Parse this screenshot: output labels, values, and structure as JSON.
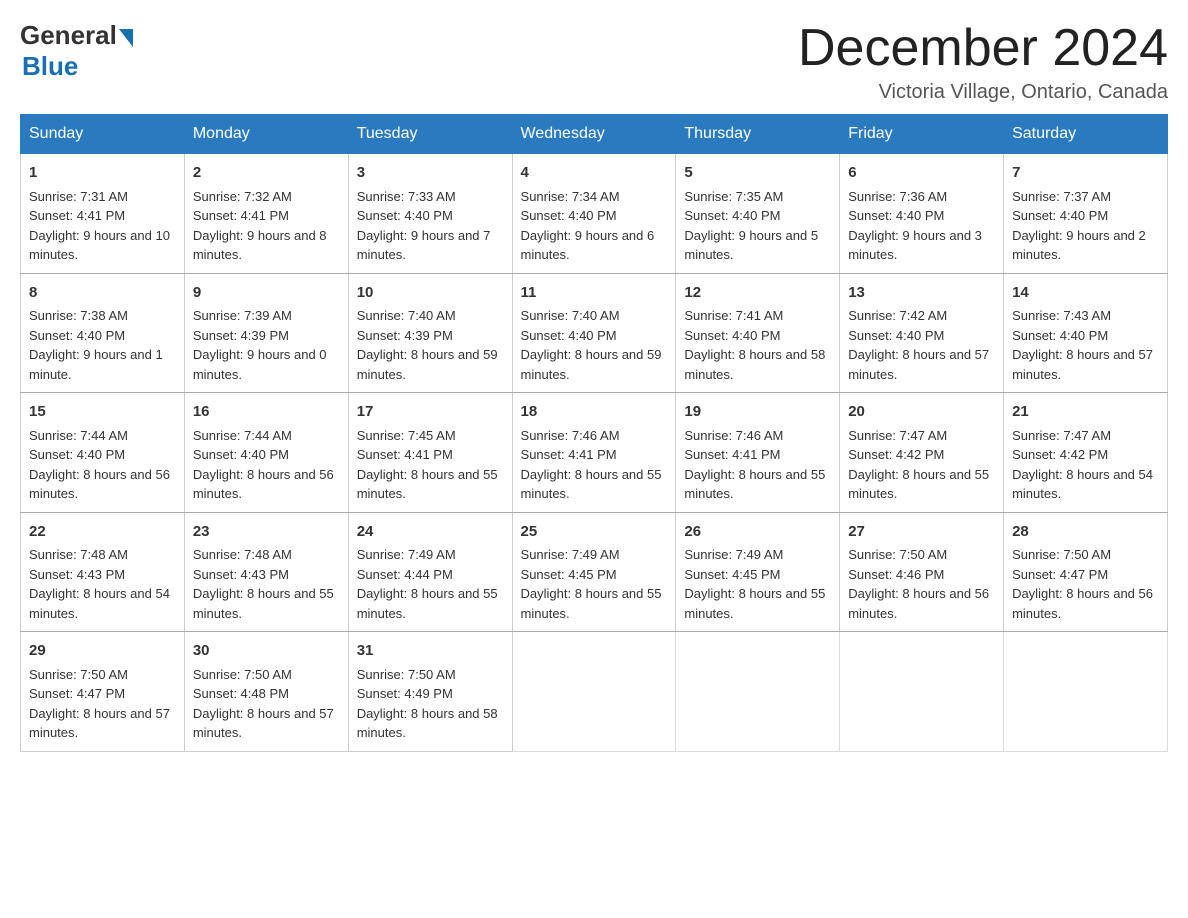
{
  "header": {
    "logo_general": "General",
    "logo_blue": "Blue",
    "month_title": "December 2024",
    "location": "Victoria Village, Ontario, Canada"
  },
  "days_of_week": [
    "Sunday",
    "Monday",
    "Tuesday",
    "Wednesday",
    "Thursday",
    "Friday",
    "Saturday"
  ],
  "weeks": [
    [
      {
        "day": "1",
        "sunrise": "Sunrise: 7:31 AM",
        "sunset": "Sunset: 4:41 PM",
        "daylight": "Daylight: 9 hours and 10 minutes."
      },
      {
        "day": "2",
        "sunrise": "Sunrise: 7:32 AM",
        "sunset": "Sunset: 4:41 PM",
        "daylight": "Daylight: 9 hours and 8 minutes."
      },
      {
        "day": "3",
        "sunrise": "Sunrise: 7:33 AM",
        "sunset": "Sunset: 4:40 PM",
        "daylight": "Daylight: 9 hours and 7 minutes."
      },
      {
        "day": "4",
        "sunrise": "Sunrise: 7:34 AM",
        "sunset": "Sunset: 4:40 PM",
        "daylight": "Daylight: 9 hours and 6 minutes."
      },
      {
        "day": "5",
        "sunrise": "Sunrise: 7:35 AM",
        "sunset": "Sunset: 4:40 PM",
        "daylight": "Daylight: 9 hours and 5 minutes."
      },
      {
        "day": "6",
        "sunrise": "Sunrise: 7:36 AM",
        "sunset": "Sunset: 4:40 PM",
        "daylight": "Daylight: 9 hours and 3 minutes."
      },
      {
        "day": "7",
        "sunrise": "Sunrise: 7:37 AM",
        "sunset": "Sunset: 4:40 PM",
        "daylight": "Daylight: 9 hours and 2 minutes."
      }
    ],
    [
      {
        "day": "8",
        "sunrise": "Sunrise: 7:38 AM",
        "sunset": "Sunset: 4:40 PM",
        "daylight": "Daylight: 9 hours and 1 minute."
      },
      {
        "day": "9",
        "sunrise": "Sunrise: 7:39 AM",
        "sunset": "Sunset: 4:39 PM",
        "daylight": "Daylight: 9 hours and 0 minutes."
      },
      {
        "day": "10",
        "sunrise": "Sunrise: 7:40 AM",
        "sunset": "Sunset: 4:39 PM",
        "daylight": "Daylight: 8 hours and 59 minutes."
      },
      {
        "day": "11",
        "sunrise": "Sunrise: 7:40 AM",
        "sunset": "Sunset: 4:40 PM",
        "daylight": "Daylight: 8 hours and 59 minutes."
      },
      {
        "day": "12",
        "sunrise": "Sunrise: 7:41 AM",
        "sunset": "Sunset: 4:40 PM",
        "daylight": "Daylight: 8 hours and 58 minutes."
      },
      {
        "day": "13",
        "sunrise": "Sunrise: 7:42 AM",
        "sunset": "Sunset: 4:40 PM",
        "daylight": "Daylight: 8 hours and 57 minutes."
      },
      {
        "day": "14",
        "sunrise": "Sunrise: 7:43 AM",
        "sunset": "Sunset: 4:40 PM",
        "daylight": "Daylight: 8 hours and 57 minutes."
      }
    ],
    [
      {
        "day": "15",
        "sunrise": "Sunrise: 7:44 AM",
        "sunset": "Sunset: 4:40 PM",
        "daylight": "Daylight: 8 hours and 56 minutes."
      },
      {
        "day": "16",
        "sunrise": "Sunrise: 7:44 AM",
        "sunset": "Sunset: 4:40 PM",
        "daylight": "Daylight: 8 hours and 56 minutes."
      },
      {
        "day": "17",
        "sunrise": "Sunrise: 7:45 AM",
        "sunset": "Sunset: 4:41 PM",
        "daylight": "Daylight: 8 hours and 55 minutes."
      },
      {
        "day": "18",
        "sunrise": "Sunrise: 7:46 AM",
        "sunset": "Sunset: 4:41 PM",
        "daylight": "Daylight: 8 hours and 55 minutes."
      },
      {
        "day": "19",
        "sunrise": "Sunrise: 7:46 AM",
        "sunset": "Sunset: 4:41 PM",
        "daylight": "Daylight: 8 hours and 55 minutes."
      },
      {
        "day": "20",
        "sunrise": "Sunrise: 7:47 AM",
        "sunset": "Sunset: 4:42 PM",
        "daylight": "Daylight: 8 hours and 55 minutes."
      },
      {
        "day": "21",
        "sunrise": "Sunrise: 7:47 AM",
        "sunset": "Sunset: 4:42 PM",
        "daylight": "Daylight: 8 hours and 54 minutes."
      }
    ],
    [
      {
        "day": "22",
        "sunrise": "Sunrise: 7:48 AM",
        "sunset": "Sunset: 4:43 PM",
        "daylight": "Daylight: 8 hours and 54 minutes."
      },
      {
        "day": "23",
        "sunrise": "Sunrise: 7:48 AM",
        "sunset": "Sunset: 4:43 PM",
        "daylight": "Daylight: 8 hours and 55 minutes."
      },
      {
        "day": "24",
        "sunrise": "Sunrise: 7:49 AM",
        "sunset": "Sunset: 4:44 PM",
        "daylight": "Daylight: 8 hours and 55 minutes."
      },
      {
        "day": "25",
        "sunrise": "Sunrise: 7:49 AM",
        "sunset": "Sunset: 4:45 PM",
        "daylight": "Daylight: 8 hours and 55 minutes."
      },
      {
        "day": "26",
        "sunrise": "Sunrise: 7:49 AM",
        "sunset": "Sunset: 4:45 PM",
        "daylight": "Daylight: 8 hours and 55 minutes."
      },
      {
        "day": "27",
        "sunrise": "Sunrise: 7:50 AM",
        "sunset": "Sunset: 4:46 PM",
        "daylight": "Daylight: 8 hours and 56 minutes."
      },
      {
        "day": "28",
        "sunrise": "Sunrise: 7:50 AM",
        "sunset": "Sunset: 4:47 PM",
        "daylight": "Daylight: 8 hours and 56 minutes."
      }
    ],
    [
      {
        "day": "29",
        "sunrise": "Sunrise: 7:50 AM",
        "sunset": "Sunset: 4:47 PM",
        "daylight": "Daylight: 8 hours and 57 minutes."
      },
      {
        "day": "30",
        "sunrise": "Sunrise: 7:50 AM",
        "sunset": "Sunset: 4:48 PM",
        "daylight": "Daylight: 8 hours and 57 minutes."
      },
      {
        "day": "31",
        "sunrise": "Sunrise: 7:50 AM",
        "sunset": "Sunset: 4:49 PM",
        "daylight": "Daylight: 8 hours and 58 minutes."
      },
      null,
      null,
      null,
      null
    ]
  ]
}
